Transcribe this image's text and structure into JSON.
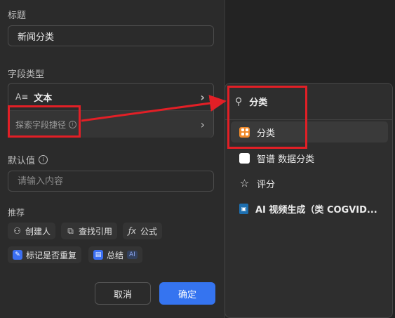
{
  "form": {
    "title_label": "标题",
    "title_value": "新闻分类",
    "field_type_label": "字段类型",
    "field_type_value": "文本",
    "field_type_icon": "text-type-icon",
    "search_shortcut_label": "探索字段捷径",
    "default_label": "默认值",
    "default_placeholder": "请输入内容",
    "recommend_label": "推荐",
    "recommendations": [
      {
        "label": "创建人",
        "icon": "user-plus-icon"
      },
      {
        "label": "查找引用",
        "icon": "lookup-icon"
      },
      {
        "label": "公式",
        "icon": "formula-icon"
      },
      {
        "label": "标记是否重复",
        "icon": "pin-icon"
      },
      {
        "label": "总结",
        "icon": "summary-icon",
        "badge": "AI"
      }
    ],
    "cancel_label": "取消",
    "confirm_label": "确定"
  },
  "dropdown": {
    "search_value": "分类",
    "items": [
      {
        "label": "分类",
        "icon": "category-grid-icon",
        "selected": true
      },
      {
        "label": "智谱 数据分类",
        "icon": "zhipu-icon"
      },
      {
        "label": "评分",
        "icon": "star-icon"
      },
      {
        "label": "AI 视频生成（类 COGVID...",
        "icon": "video-gen-icon"
      }
    ]
  },
  "colors": {
    "accent": "#3574f0",
    "annotation": "#e21f26",
    "category_icon": "#f08a2b"
  }
}
